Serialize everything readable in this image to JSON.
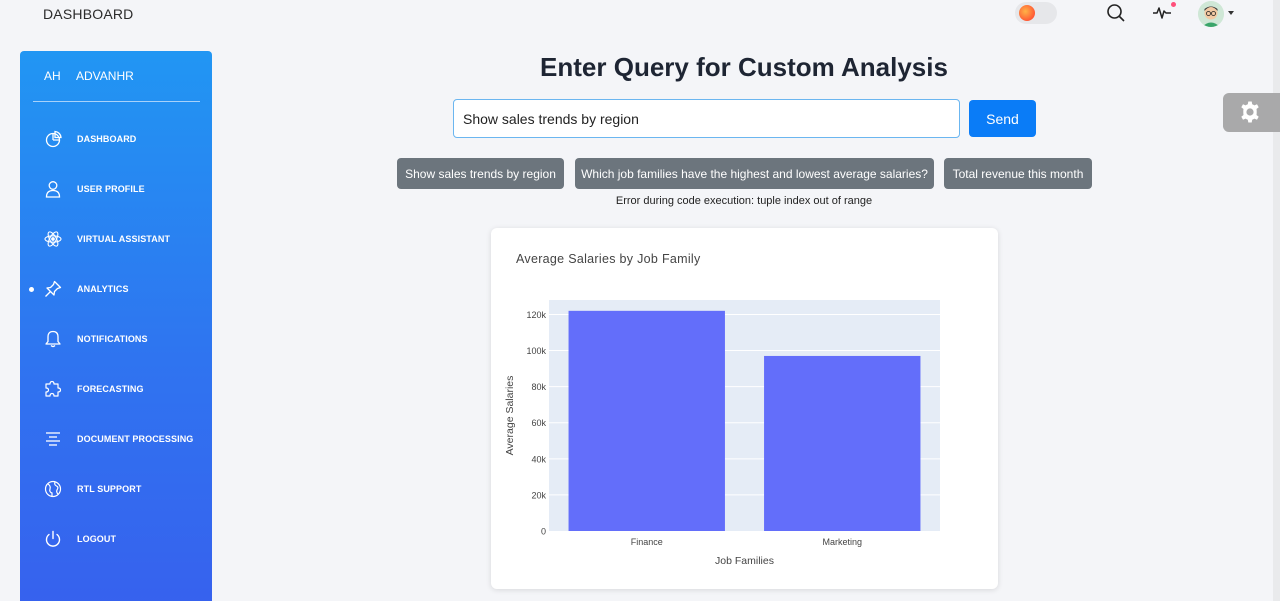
{
  "header": {
    "title": "DASHBOARD",
    "icons": [
      "theme-toggle",
      "search-icon",
      "activity-icon",
      "avatar"
    ]
  },
  "sidebar": {
    "logo_mini": "AH",
    "logo_normal": "ADVANHR",
    "active_item": "ANALYTICS",
    "items": [
      {
        "label": "DASHBOARD",
        "icon": "chart-pie-icon"
      },
      {
        "label": "USER PROFILE",
        "icon": "user-icon"
      },
      {
        "label": "VIRTUAL ASSISTANT",
        "icon": "atom-icon"
      },
      {
        "label": "ANALYTICS",
        "icon": "pin-icon"
      },
      {
        "label": "NOTIFICATIONS",
        "icon": "bell-icon"
      },
      {
        "label": "FORECASTING",
        "icon": "puzzle-icon"
      },
      {
        "label": "DOCUMENT PROCESSING",
        "icon": "align-center-icon"
      },
      {
        "label": "RTL SUPPORT",
        "icon": "world-icon"
      },
      {
        "label": "LOGOUT",
        "icon": "power-icon"
      }
    ]
  },
  "main": {
    "title": "Enter Query for Custom Analysis",
    "query_value": "Show sales trends by region",
    "send_label": "Send",
    "suggestions": [
      "Show sales trends by region",
      "Which job families have the highest and lowest average salaries?",
      "Total revenue this month"
    ],
    "error": "Error during code execution: tuple index out of range"
  },
  "colors": {
    "sidebar_top": "#2196f3",
    "sidebar_bottom": "#3761ee",
    "send_button": "#0a7cf7",
    "chip": "#6c757d",
    "bar": "#636efa",
    "plot_bg": "#e5ecf6"
  },
  "chart_data": {
    "type": "bar",
    "title": "Average Salaries by Job Family",
    "xlabel": "Job Families",
    "ylabel": "Average Salaries",
    "categories": [
      "Finance",
      "Marketing"
    ],
    "values": [
      122000,
      97000
    ],
    "ylim": [
      0,
      128000
    ],
    "yticks": [
      0,
      20000,
      40000,
      60000,
      80000,
      100000,
      120000
    ],
    "ytick_labels": [
      "0",
      "20k",
      "40k",
      "60k",
      "80k",
      "100k",
      "120k"
    ],
    "grid": true,
    "legend": "none"
  }
}
